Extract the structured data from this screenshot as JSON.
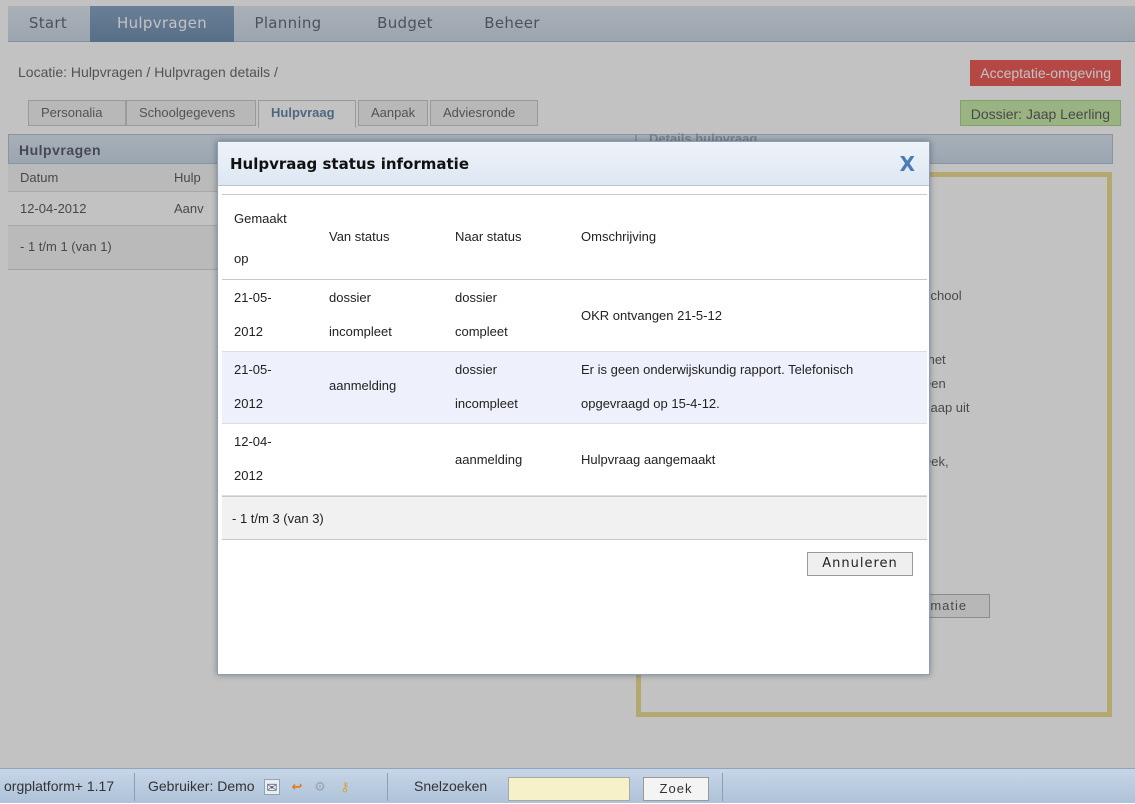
{
  "nav": {
    "tabs": [
      "Start",
      "Hulpvragen",
      "Planning",
      "Budget",
      "Beheer"
    ],
    "active": "Hulpvragen"
  },
  "breadcrumb": "Locatie: Hulpvragen / Hulpvragen details /",
  "env_badge": "Acceptatie-omgeving",
  "dossier_badge": "Dossier: Jaap Leerling",
  "subtabs": [
    "Personalia",
    "Schoolgegevens",
    "Hulpvraag",
    "Aanpak",
    "Adviesronde"
  ],
  "left_panel": {
    "title": "Hulpvragen",
    "columns": [
      "Datum",
      "Hulp"
    ],
    "rows": [
      [
        "12-04-2012",
        "Aanv"
      ]
    ],
    "footer": "- 1 t/m 1 (van 1)"
  },
  "right_panel": {
    "title": "Details hulpvraag",
    "visible_fragments": [
      "school",
      "met",
      "een",
      "Jaap uit",
      "eek,"
    ],
    "button_label": "rmatie"
  },
  "status_bar": {
    "version": "orgplatform+ 1.17",
    "user": "Gebruiker: Demo",
    "search_label": "Snelzoeken",
    "search_value": "",
    "search_button": "Zoek",
    "icons": [
      "mail-icon",
      "arrow-icon",
      "gear-icon",
      "key-icon"
    ]
  },
  "modal": {
    "title": "Hulpvraag status informatie",
    "close_label": "X",
    "columns": {
      "made_on_line1": "Gemaakt",
      "made_on_line2": "op",
      "from_status": "Van status",
      "to_status": "Naar status",
      "description": "Omschrijving"
    },
    "rows": [
      {
        "date_l1": "21-05-",
        "date_l2": "2012",
        "from_l1": "dossier",
        "from_l2": "incompleet",
        "to_l1": "dossier",
        "to_l2": "compleet",
        "desc_l1": "OKR ontvangen 21-5-12",
        "desc_l2": ""
      },
      {
        "date_l1": "21-05-",
        "date_l2": "2012",
        "from_l1": "aanmelding",
        "from_l2": "",
        "to_l1": "dossier",
        "to_l2": "incompleet",
        "desc_l1": "Er is geen onderwijskundig rapport. Telefonisch",
        "desc_l2": "opgevraagd op 15-4-12."
      },
      {
        "date_l1": "12-04-",
        "date_l2": "2012",
        "from_l1": "",
        "from_l2": "",
        "to_l1": "aanmelding",
        "to_l2": "",
        "desc_l1": "Hulpvraag aangemaakt",
        "desc_l2": ""
      }
    ],
    "footer": "- 1 t/m 3 (van 3)",
    "cancel_label": "Annuleren"
  },
  "colors": {
    "nav_active": "#3d6796",
    "env_badge": "#e8201c",
    "dossier_badge": "#b5e68b",
    "detail_border": "#e3d06b",
    "close_x": "#4a7db5"
  }
}
